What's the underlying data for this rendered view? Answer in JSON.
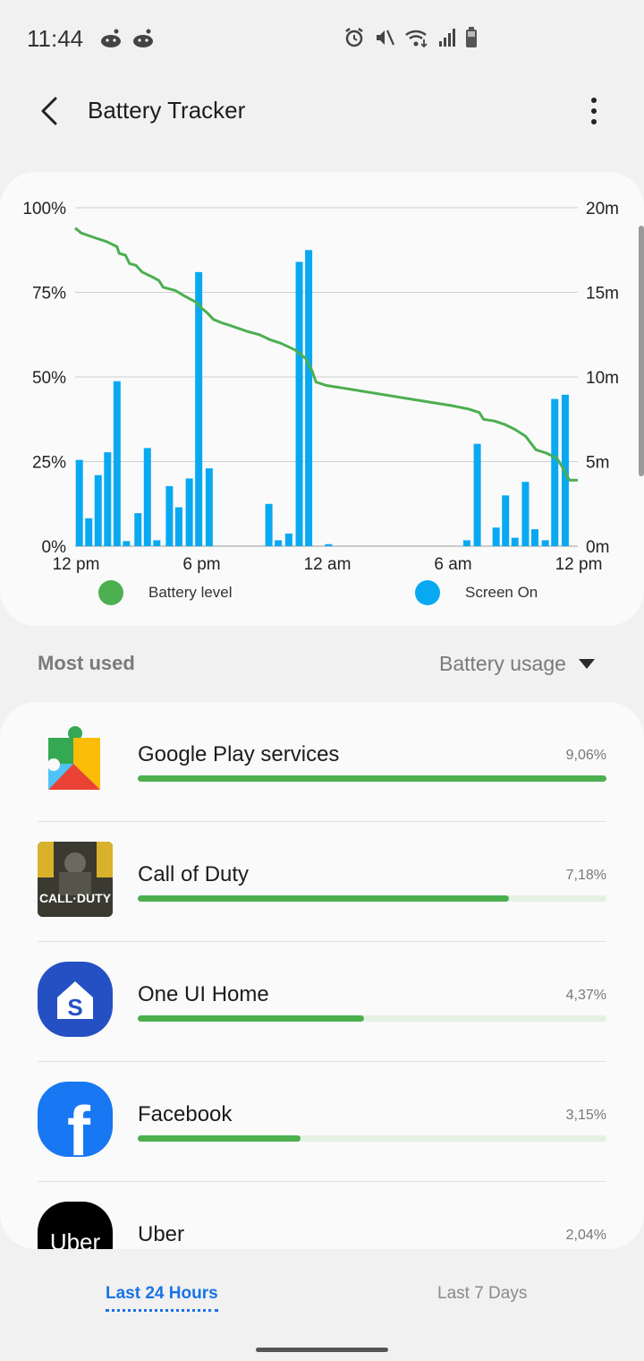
{
  "status_bar": {
    "time": "11:44",
    "left_icons": [
      "reddit-icon",
      "reddit-icon"
    ],
    "right_icons": [
      "alarm-icon",
      "mute-icon",
      "wifi-icon",
      "signal-icon",
      "battery-icon"
    ]
  },
  "header": {
    "title": "Battery Tracker",
    "back_icon": "back-arrow-icon",
    "more_icon": "more-vert-icon"
  },
  "chart_data": {
    "type": "bar",
    "x_tick_labels": [
      "12 pm",
      "6 pm",
      "12 am",
      "6 am",
      "12 pm"
    ],
    "y_left_ticks": [
      "0%",
      "25%",
      "50%",
      "75%",
      "100%"
    ],
    "y_right_ticks": [
      "0m",
      "5m",
      "10m",
      "15m",
      "20m"
    ],
    "ylim_left": [
      0,
      100
    ],
    "ylim_right": [
      0,
      20
    ],
    "xlim_hours": [
      0,
      24
    ],
    "grid": true,
    "series": [
      {
        "name": "Screen On",
        "type": "bar",
        "axis": "right",
        "color": "#09a9f2",
        "bars": [
          {
            "x": 0.2,
            "y": 5.1
          },
          {
            "x": 0.65,
            "y": 1.65
          },
          {
            "x": 1.1,
            "y": 4.2
          },
          {
            "x": 1.55,
            "y": 5.55
          },
          {
            "x": 2.0,
            "y": 9.75
          },
          {
            "x": 2.45,
            "y": 0.3
          },
          {
            "x": 3.0,
            "y": 1.95
          },
          {
            "x": 3.45,
            "y": 5.8
          },
          {
            "x": 3.9,
            "y": 0.35
          },
          {
            "x": 4.5,
            "y": 3.55
          },
          {
            "x": 4.95,
            "y": 2.3
          },
          {
            "x": 5.45,
            "y": 4.0
          },
          {
            "x": 5.9,
            "y": 16.2
          },
          {
            "x": 6.4,
            "y": 4.6
          },
          {
            "x": 9.25,
            "y": 2.5
          },
          {
            "x": 9.7,
            "y": 0.35
          },
          {
            "x": 10.2,
            "y": 0.75
          },
          {
            "x": 10.7,
            "y": 16.8
          },
          {
            "x": 11.15,
            "y": 17.5
          },
          {
            "x": 12.1,
            "y": 0.12
          },
          {
            "x": 18.7,
            "y": 0.35
          },
          {
            "x": 19.2,
            "y": 6.05
          },
          {
            "x": 20.1,
            "y": 1.1
          },
          {
            "x": 20.55,
            "y": 3.0
          },
          {
            "x": 21.0,
            "y": 0.5
          },
          {
            "x": 21.5,
            "y": 3.8
          },
          {
            "x": 21.95,
            "y": 1.0
          },
          {
            "x": 22.45,
            "y": 0.35
          },
          {
            "x": 22.9,
            "y": 8.7
          },
          {
            "x": 23.4,
            "y": 8.95
          }
        ]
      },
      {
        "name": "Battery level",
        "type": "line",
        "axis": "left",
        "color": "#4caf50",
        "points": [
          [
            0,
            94
          ],
          [
            0.3,
            92.5
          ],
          [
            1.0,
            91
          ],
          [
            1.5,
            90
          ],
          [
            2.0,
            88.5
          ],
          [
            2.1,
            86.5
          ],
          [
            2.4,
            86
          ],
          [
            2.6,
            83.5
          ],
          [
            2.9,
            83
          ],
          [
            3.2,
            81
          ],
          [
            3.7,
            79.5
          ],
          [
            4.0,
            78.5
          ],
          [
            4.2,
            76.5
          ],
          [
            4.8,
            75.5
          ],
          [
            5.2,
            74
          ],
          [
            5.8,
            72
          ],
          [
            6.0,
            70.5
          ],
          [
            6.3,
            69
          ],
          [
            6.6,
            67
          ],
          [
            7.0,
            66
          ],
          [
            7.5,
            65
          ],
          [
            8.2,
            63.5
          ],
          [
            8.8,
            62.5
          ],
          [
            9.3,
            61
          ],
          [
            9.8,
            60
          ],
          [
            10.5,
            58
          ],
          [
            11.0,
            55.5
          ],
          [
            11.3,
            52
          ],
          [
            11.5,
            48.5
          ],
          [
            12.0,
            47.5
          ],
          [
            13.0,
            46.5
          ],
          [
            14.0,
            45.5
          ],
          [
            15.0,
            44.5
          ],
          [
            16.0,
            43.5
          ],
          [
            17.0,
            42.5
          ],
          [
            18.0,
            41.5
          ],
          [
            18.8,
            40.5
          ],
          [
            19.3,
            39.5
          ],
          [
            19.5,
            37.5
          ],
          [
            20.0,
            37
          ],
          [
            20.5,
            36
          ],
          [
            21.0,
            34.5
          ],
          [
            21.5,
            32.5
          ],
          [
            22.0,
            28.5
          ],
          [
            22.5,
            27.5
          ],
          [
            23.0,
            26
          ],
          [
            23.3,
            23
          ],
          [
            23.6,
            19.5
          ],
          [
            24.0,
            19.5
          ]
        ]
      }
    ],
    "legend": [
      {
        "label": "Battery level",
        "color": "#4caf50"
      },
      {
        "label": "Screen On",
        "color": "#09a9f2"
      }
    ]
  },
  "usage": {
    "section_title": "Most used",
    "sort_label": "Battery usage",
    "apps": [
      {
        "name": "Google Play services",
        "percent": "9,06%",
        "value": 9.06,
        "icon": "google-play-services-icon"
      },
      {
        "name": "Call of Duty",
        "percent": "7,18%",
        "value": 7.18,
        "icon": "call-of-duty-icon",
        "icon_text": "CALL·DUTY"
      },
      {
        "name": "One UI Home",
        "percent": "4,37%",
        "value": 4.37,
        "icon": "one-ui-home-icon",
        "icon_text": "S"
      },
      {
        "name": "Facebook",
        "percent": "3,15%",
        "value": 3.15,
        "icon": "facebook-icon",
        "icon_text": "f"
      },
      {
        "name": "Uber",
        "percent": "2,04%",
        "value": 2.04,
        "icon": "uber-icon",
        "icon_text": "Uber"
      }
    ]
  },
  "tabs": [
    {
      "label": "Last 24 Hours",
      "active": true
    },
    {
      "label": "Last 7 Days",
      "active": false
    }
  ]
}
